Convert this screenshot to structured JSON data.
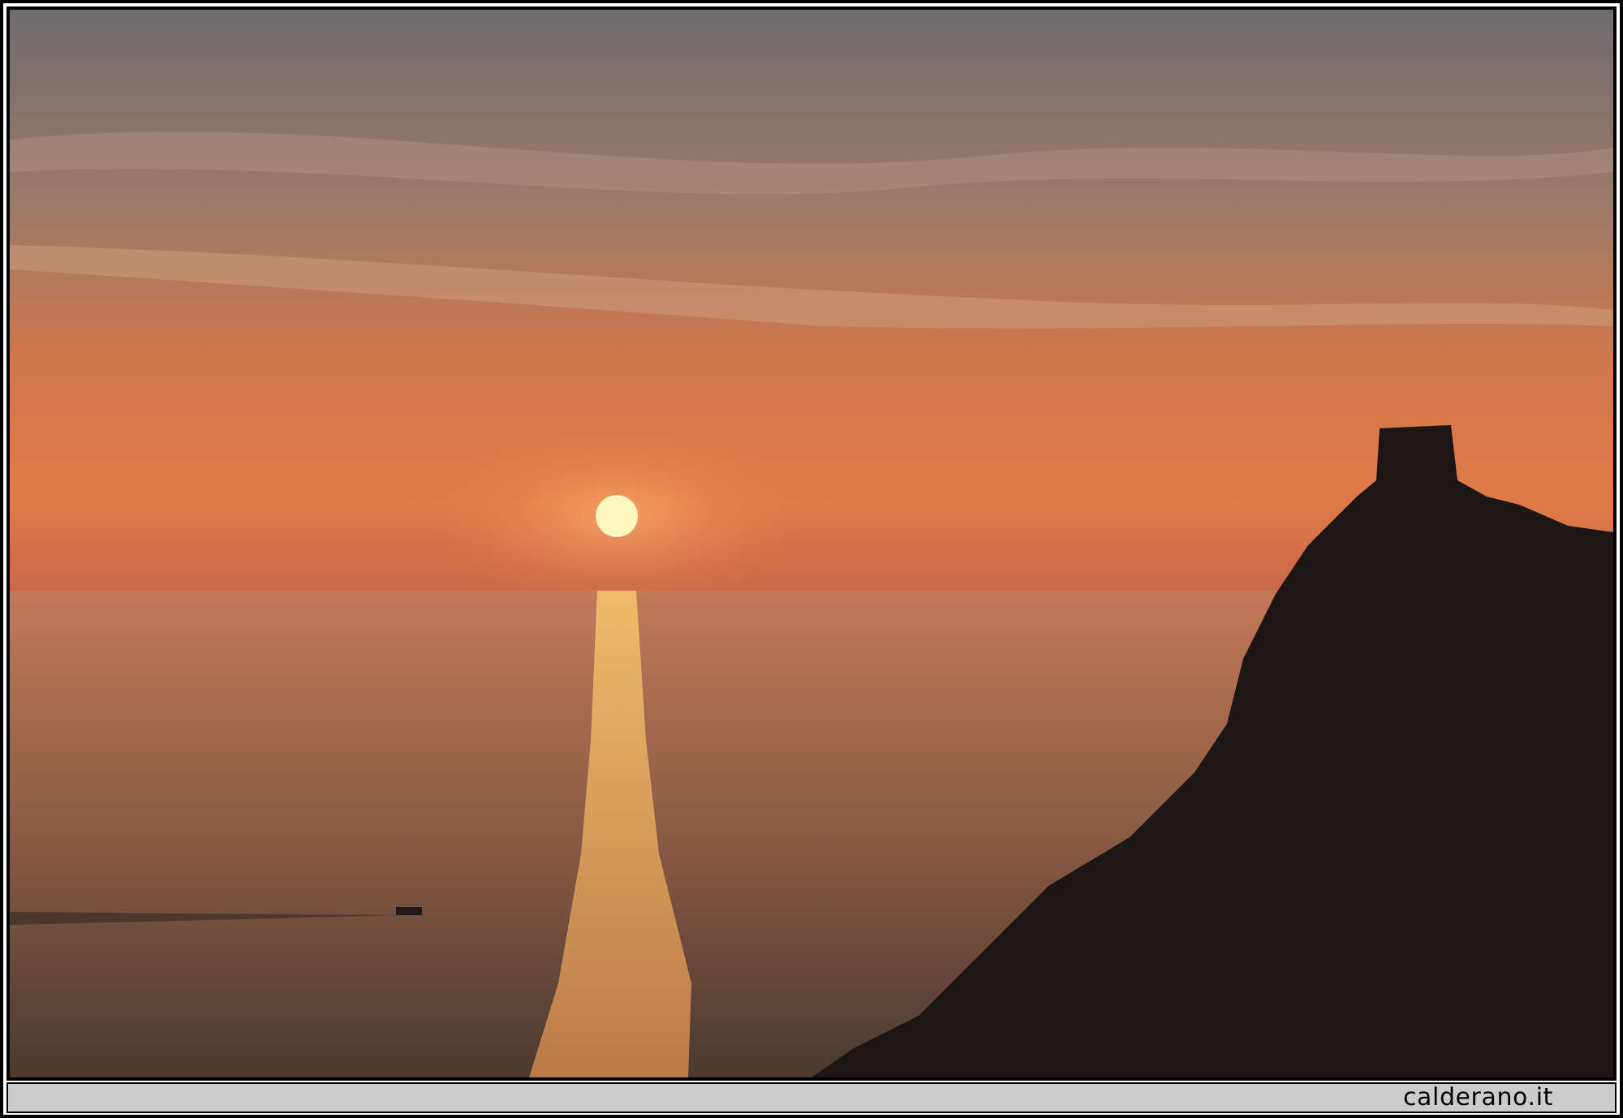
{
  "caption_bar": {
    "text": "calderano.it"
  }
}
